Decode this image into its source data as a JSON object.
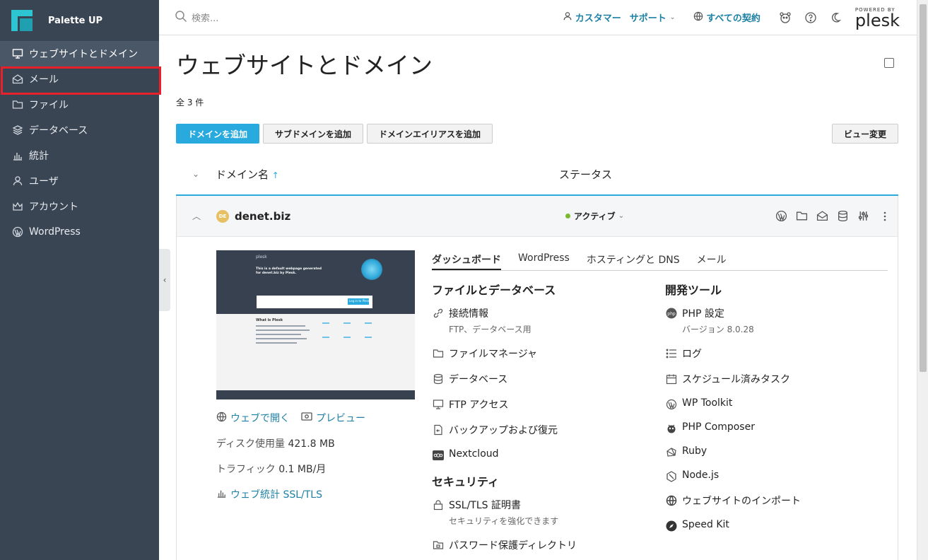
{
  "sidebar": {
    "brand": "Palette UP",
    "items": [
      {
        "label": "ウェブサイトとドメイン"
      },
      {
        "label": "メール"
      },
      {
        "label": "ファイル"
      },
      {
        "label": "データベース"
      },
      {
        "label": "統計"
      },
      {
        "label": "ユーザ"
      },
      {
        "label": "アカウント"
      },
      {
        "label": "WordPress"
      }
    ]
  },
  "topbar": {
    "search_placeholder": "検索...",
    "customer": "カスタマー",
    "support": "サポート",
    "subscriptions": "すべての契約",
    "powered_by": "POWERED BY",
    "plesk": "plesk"
  },
  "main": {
    "title": "ウェブサイトとドメイン",
    "count": "全 3 件",
    "buttons": {
      "add_domain": "ドメインを追加",
      "add_subdomain": "サブドメインを追加",
      "add_alias": "ドメインエイリアスを追加",
      "change_view": "ビュー変更"
    },
    "columns": {
      "name": "ドメイン名",
      "status": "ステータス"
    },
    "domain": {
      "badge": "DE",
      "name": "denet.biz",
      "status": "アクティブ"
    },
    "links": {
      "open_web": "ウェブで開く",
      "preview": "プレビュー",
      "disk_label": "ディスク使用量",
      "disk_value": "421.8 MB",
      "traffic_label": "トラフィック",
      "traffic_value": "0.1 MB/月",
      "webstats": "ウェブ統計 SSL/TLS"
    },
    "tabs": [
      "ダッシュボード",
      "WordPress",
      "ホスティングと DNS",
      "メール"
    ],
    "files_title": "ファイルとデータベース",
    "files_items": [
      {
        "label": "接続情報",
        "sub": "FTP、データベース用"
      },
      {
        "label": "ファイルマネージャ",
        "sub": ""
      },
      {
        "label": "データベース",
        "sub": ""
      },
      {
        "label": "FTP アクセス",
        "sub": ""
      },
      {
        "label": "バックアップおよび復元",
        "sub": ""
      },
      {
        "label": "Nextcloud",
        "sub": ""
      }
    ],
    "security_title": "セキュリティ",
    "security_items": [
      {
        "label": "SSL/TLS 証明書",
        "sub": "セキュリティを強化できます"
      },
      {
        "label": "パスワード保護ディレクトリ",
        "sub": ""
      }
    ],
    "dev_title": "開発ツール",
    "dev_items": [
      {
        "label": "PHP 設定",
        "sub": "バージョン 8.0.28"
      },
      {
        "label": "ログ",
        "sub": ""
      },
      {
        "label": "スケジュール済みタスク",
        "sub": ""
      },
      {
        "label": "WP Toolkit",
        "sub": ""
      },
      {
        "label": "PHP Composer",
        "sub": ""
      },
      {
        "label": "Ruby",
        "sub": ""
      },
      {
        "label": "Node.js",
        "sub": ""
      },
      {
        "label": "ウェブサイトのインポート",
        "sub": ""
      },
      {
        "label": "Speed Kit",
        "sub": ""
      }
    ],
    "preview_texts": {
      "brand": "plesk",
      "headline": "This is a default webpage generated for denet.biz by Plesk.",
      "cta": "Log in to Plesk",
      "what": "What is Plesk"
    }
  },
  "colors": {
    "accent": "#28aade",
    "sidebar": "#3a4553",
    "active_status": "#7cb82f",
    "highlight": "#e8202a"
  }
}
